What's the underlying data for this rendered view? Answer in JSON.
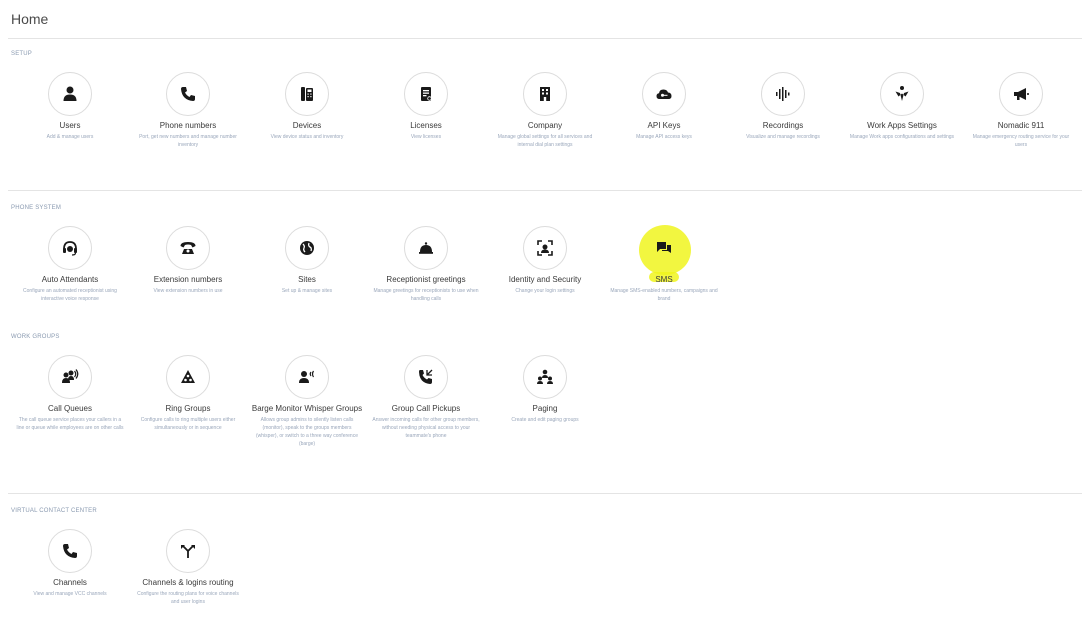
{
  "page": {
    "title": "Home"
  },
  "sections": {
    "setup": {
      "label": "SETUP",
      "tiles": [
        {
          "icon": "user-icon",
          "title": "Users",
          "desc": "Add & manage users"
        },
        {
          "icon": "phone-icon",
          "title": "Phone numbers",
          "desc": "Port, get new numbers and manage number inventory"
        },
        {
          "icon": "desk-phone-icon",
          "title": "Devices",
          "desc": "View device status and inventory"
        },
        {
          "icon": "license-icon",
          "title": "Licenses",
          "desc": "View licenses"
        },
        {
          "icon": "building-icon",
          "title": "Company",
          "desc": "Manage global settings for all services and internal dial plan settings"
        },
        {
          "icon": "cloud-key-icon",
          "title": "API Keys",
          "desc": "Manage API access keys"
        },
        {
          "icon": "waveform-icon",
          "title": "Recordings",
          "desc": "Visualize and manage recordings"
        },
        {
          "icon": "work-apps-icon",
          "title": "Work Apps Settings",
          "desc": "Manage Work apps configurations and settings"
        },
        {
          "icon": "megaphone-icon",
          "title": "Nomadic 911",
          "desc": "Manage emergency routing service for your users"
        }
      ]
    },
    "phone_system": {
      "label": "PHONE SYSTEM",
      "tiles": [
        {
          "icon": "headset-icon",
          "title": "Auto Attendants",
          "desc": "Configure an automated receptionist using interactive voice response"
        },
        {
          "icon": "extension-phone-icon",
          "title": "Extension numbers",
          "desc": "View extension numbers in use"
        },
        {
          "icon": "globe-icon",
          "title": "Sites",
          "desc": "Set up & manage sites"
        },
        {
          "icon": "bell-icon",
          "title": "Receptionist greetings",
          "desc": "Manage greetings for receptionists to use when handling calls"
        },
        {
          "icon": "face-scan-icon",
          "title": "Identity and Security",
          "desc": "Change your login settings"
        },
        {
          "icon": "chat-bubbles-icon",
          "title": "SMS",
          "desc": "Manage SMS-enabled numbers, campaigns and brand"
        }
      ]
    },
    "work_groups": {
      "label": "WORK GROUPS",
      "tiles": [
        {
          "icon": "call-queue-icon",
          "title": "Call Queues",
          "desc": "The call queue service places your callers in a line or queue while employees are on other calls"
        },
        {
          "icon": "ring-group-icon",
          "title": "Ring Groups",
          "desc": "Configure calls to ring multiple users either simultaneously or in sequence"
        },
        {
          "icon": "barge-monitor-icon",
          "title": "Barge Monitor Whisper Groups",
          "desc": "Allows group admins to silently listen calls (monitor), speak to the groups members (whisper), or switch to a three way conference (barge)"
        },
        {
          "icon": "call-pickup-icon",
          "title": "Group Call Pickups",
          "desc": "Answer incoming calls for other group members, without needing physical access to your teammate's phone"
        },
        {
          "icon": "paging-icon",
          "title": "Paging",
          "desc": "Create and edit paging groups"
        }
      ]
    },
    "virtual_contact_center": {
      "label": "VIRTUAL CONTACT CENTER",
      "tiles": [
        {
          "icon": "phone-icon",
          "title": "Channels",
          "desc": "View and manage VCC channels"
        },
        {
          "icon": "routing-icon",
          "title": "Channels & logins routing",
          "desc": "Configure the routing plans for voice channels and user logins"
        }
      ]
    }
  },
  "highlight_color": "#f0f51e",
  "accent_color": "#1a1a1a"
}
